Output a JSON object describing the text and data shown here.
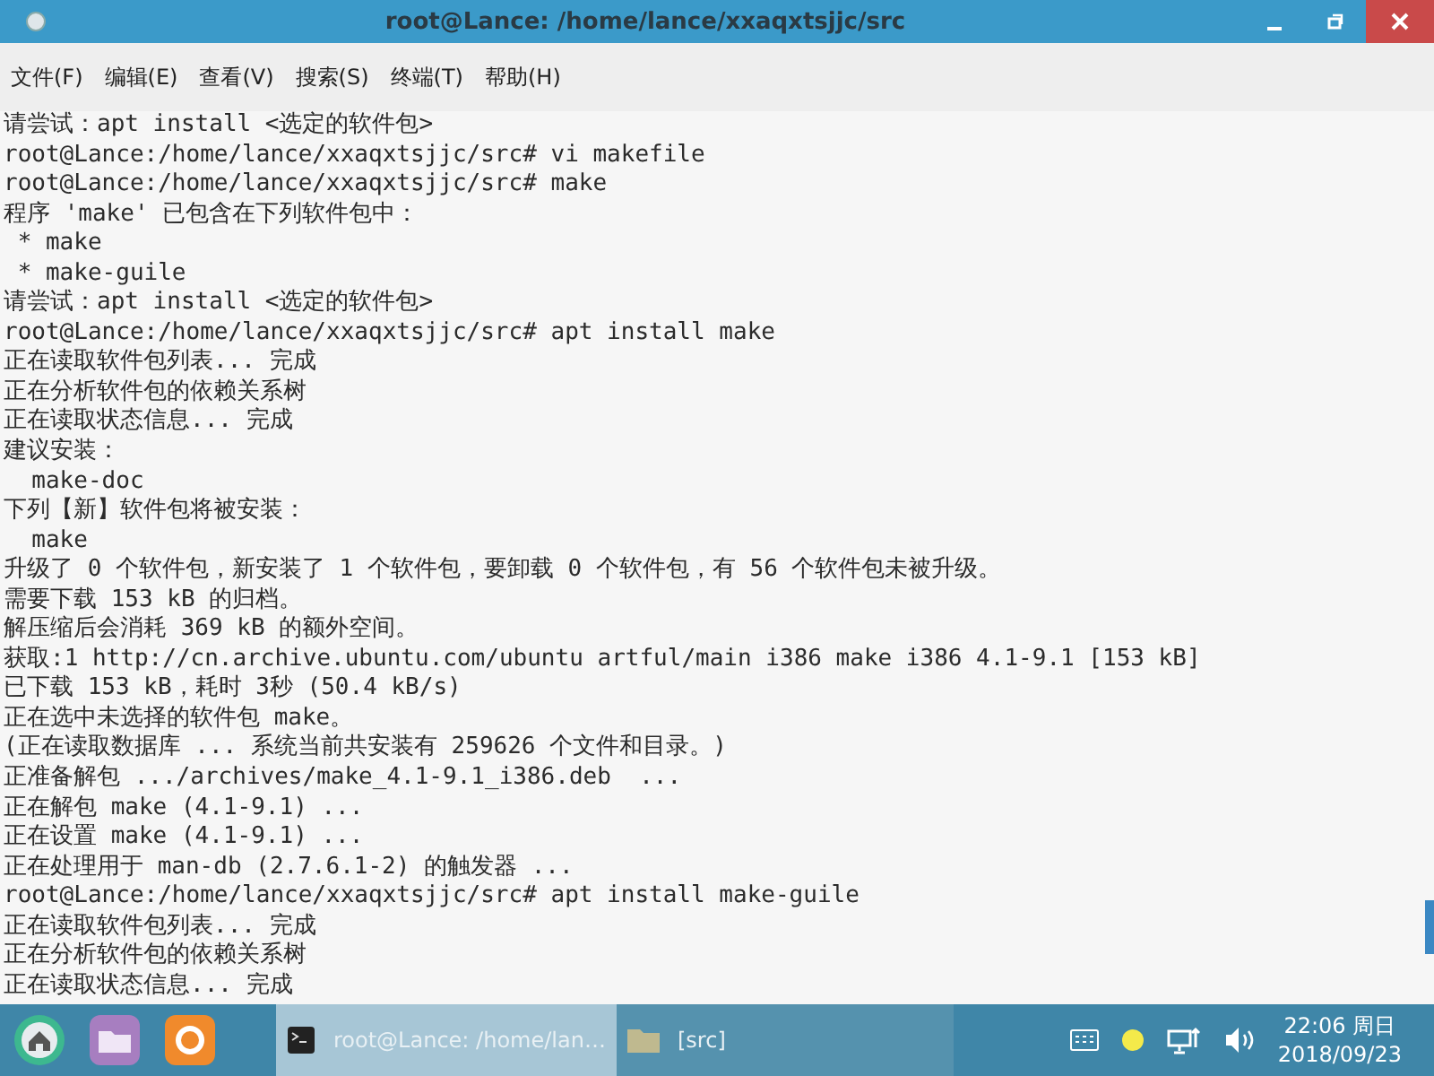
{
  "window": {
    "title": "root@Lance: /home/lance/xxaqxtsjjc/src"
  },
  "menu": [
    "文件(F)",
    "编辑(E)",
    "查看(V)",
    "搜索(S)",
    "终端(T)",
    "帮助(H)"
  ],
  "terminal": {
    "lines": [
      "请尝试：apt install <选定的软件包>",
      "root@Lance:/home/lance/xxaqxtsjjc/src# vi makefile",
      "root@Lance:/home/lance/xxaqxtsjjc/src# make",
      "程序 'make' 已包含在下列软件包中：",
      " * make",
      " * make-guile",
      "请尝试：apt install <选定的软件包>",
      "root@Lance:/home/lance/xxaqxtsjjc/src# apt install make",
      "正在读取软件包列表... 完成",
      "正在分析软件包的依赖关系树",
      "正在读取状态信息... 完成",
      "建议安装：",
      "  make-doc",
      "下列【新】软件包将被安装：",
      "  make",
      "升级了 0 个软件包，新安装了 1 个软件包，要卸载 0 个软件包，有 56 个软件包未被升级。",
      "需要下载 153 kB 的归档。",
      "解压缩后会消耗 369 kB 的额外空间。",
      "获取:1 http://cn.archive.ubuntu.com/ubuntu artful/main i386 make i386 4.1-9.1 [153 kB]",
      "已下载 153 kB，耗时 3秒 (50.4 kB/s)",
      "正在选中未选择的软件包 make。",
      "(正在读取数据库 ... 系统当前共安装有 259626 个文件和目录。)",
      "正准备解包 .../archives/make_4.1-9.1_i386.deb  ...",
      "正在解包 make (4.1-9.1) ...",
      "正在设置 make (4.1-9.1) ...",
      "正在处理用于 man-db (2.7.6.1-2) 的触发器 ...",
      "root@Lance:/home/lance/xxaqxtsjjc/src# apt install make-guile",
      "正在读取软件包列表... 完成",
      "正在分析软件包的依赖关系树",
      "正在读取状态信息... 完成"
    ]
  },
  "taskbar": {
    "tasks": [
      {
        "kind": "terminal",
        "label": "root@Lance: /home/lan…",
        "selected": true
      },
      {
        "kind": "folder",
        "label": "[src]",
        "selected": false
      }
    ],
    "clock": {
      "time": "22:06 周日",
      "date": "2018/09/23"
    }
  }
}
